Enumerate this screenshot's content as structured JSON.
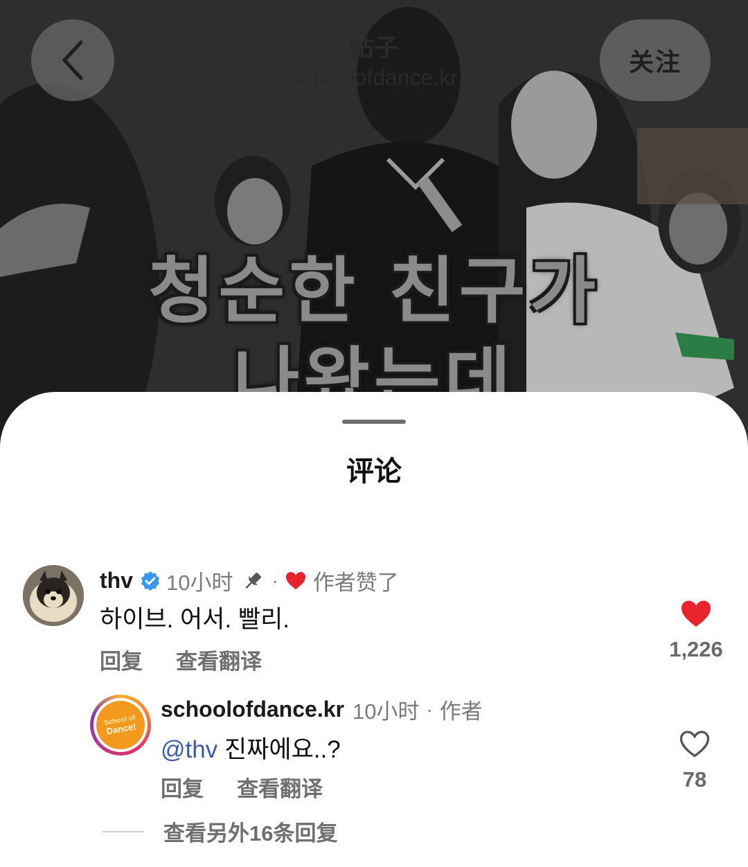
{
  "header": {
    "title": "帖子",
    "username": "schoolofdance.kr",
    "follow_label": "关注"
  },
  "video": {
    "caption_line1": "청순한 친구가",
    "caption_line2": "나왔는데"
  },
  "sheet": {
    "title": "评论"
  },
  "comments": [
    {
      "username": "thv",
      "verified": true,
      "time": "10小时",
      "pinned": true,
      "author_liked_label": "作者赞了",
      "text": "하이브. 어서. 빨리.",
      "reply_label": "回复",
      "translate_label": "查看翻译",
      "like_count": "1,226",
      "liked": true,
      "avatar_icon": "pomeranian-dog-avatar",
      "reply": {
        "username": "schoolofdance.kr",
        "time": "10小时",
        "author_label": "作者",
        "mention": "@thv",
        "text": "진짜에요..?",
        "reply_label": "回复",
        "translate_label": "查看翻译",
        "like_count": "78",
        "liked": false,
        "avatar_icon": "school-of-dance-logo",
        "avatar_logo_text": "School of Dance!"
      },
      "view_more_label": "查看另外16条回复"
    }
  ],
  "colors": {
    "heart_red": "#e8232e",
    "mention_blue": "#3b5bab",
    "verified_blue": "#3897f0"
  }
}
